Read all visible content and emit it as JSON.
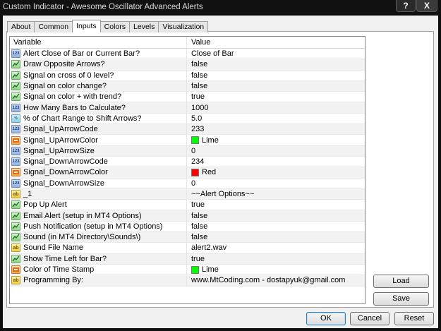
{
  "window": {
    "title": "Custom Indicator - Awesome Oscillator Advanced Alerts",
    "help_label": "?",
    "close_label": "X"
  },
  "tabs": [
    {
      "label": "About",
      "active": false
    },
    {
      "label": "Common",
      "active": false
    },
    {
      "label": "Inputs",
      "active": true
    },
    {
      "label": "Colors",
      "active": false
    },
    {
      "label": "Levels",
      "active": false
    },
    {
      "label": "Visualization",
      "active": false
    }
  ],
  "grid": {
    "columns": {
      "variable": "Variable",
      "value": "Value"
    },
    "rows": [
      {
        "type": "int",
        "name": "Alert Close of Bar or Current Bar?",
        "value": "Close of Bar"
      },
      {
        "type": "bool",
        "name": "Draw Opposite Arrows?",
        "value": "false"
      },
      {
        "type": "bool",
        "name": "Signal on cross of 0 level?",
        "value": "false"
      },
      {
        "type": "bool",
        "name": "Signal on color change?",
        "value": "false"
      },
      {
        "type": "bool",
        "name": "Signal on color + with trend?",
        "value": "true"
      },
      {
        "type": "int",
        "name": "How Many Bars to Calculate?",
        "value": "1000"
      },
      {
        "type": "double",
        "name": "% of Chart Range to Shift Arrows?",
        "value": "5.0"
      },
      {
        "type": "int",
        "name": "Signal_UpArrowCode",
        "value": "233"
      },
      {
        "type": "color",
        "name": "Signal_UpArrowColor",
        "value": "Lime",
        "swatch": "#00ff00"
      },
      {
        "type": "int",
        "name": "Signal_UpArrowSize",
        "value": "0"
      },
      {
        "type": "int",
        "name": "Signal_DownArrowCode",
        "value": "234"
      },
      {
        "type": "color",
        "name": "Signal_DownArrowColor",
        "value": "Red",
        "swatch": "#ff0000"
      },
      {
        "type": "int",
        "name": "Signal_DownArrowSize",
        "value": "0"
      },
      {
        "type": "string",
        "name": "_1",
        "value": "~~Alert Options~~"
      },
      {
        "type": "bool",
        "name": "Pop Up Alert",
        "value": "true"
      },
      {
        "type": "bool",
        "name": "Email Alert (setup in MT4 Options)",
        "value": "false"
      },
      {
        "type": "bool",
        "name": "Push Notification (setup in MT4 Options)",
        "value": "false"
      },
      {
        "type": "bool",
        "name": "Sound (in MT4 Directory\\Sounds\\)",
        "value": "false"
      },
      {
        "type": "string",
        "name": "Sound File Name",
        "value": "alert2.wav"
      },
      {
        "type": "bool",
        "name": "Show Time Left for Bar?",
        "value": "true"
      },
      {
        "type": "color",
        "name": "Color of Time Stamp",
        "value": "Lime",
        "swatch": "#00ff00"
      },
      {
        "type": "string",
        "name": "Programming By:",
        "value": "www.MtCoding.com - dostapyuk@gmail.com"
      }
    ]
  },
  "icon_text": {
    "int": "123",
    "double": "½",
    "string": "ab"
  },
  "buttons": {
    "load": "Load",
    "save": "Save",
    "ok": "OK",
    "cancel": "Cancel",
    "reset": "Reset"
  }
}
